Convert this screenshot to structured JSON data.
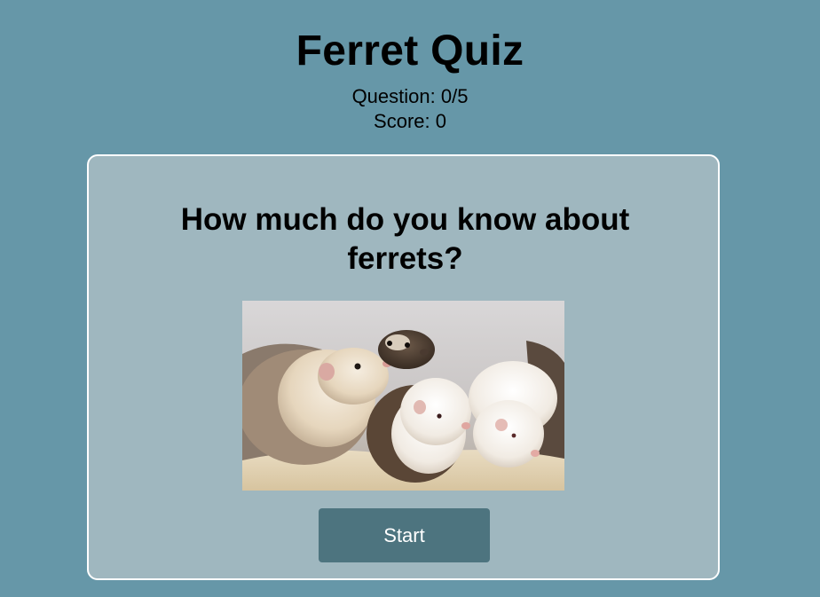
{
  "header": {
    "title": "Ferret Quiz",
    "question_counter": "Question: 0/5",
    "score": "Score: 0"
  },
  "card": {
    "question": "How much do you know about ferrets?",
    "image_alt": "ferrets",
    "start_label": "Start"
  },
  "colors": {
    "background": "#6697a8",
    "card_background": "#9fb7bf",
    "card_border": "#ffffff",
    "button_background": "#4d747f",
    "button_text": "#ffffff"
  }
}
